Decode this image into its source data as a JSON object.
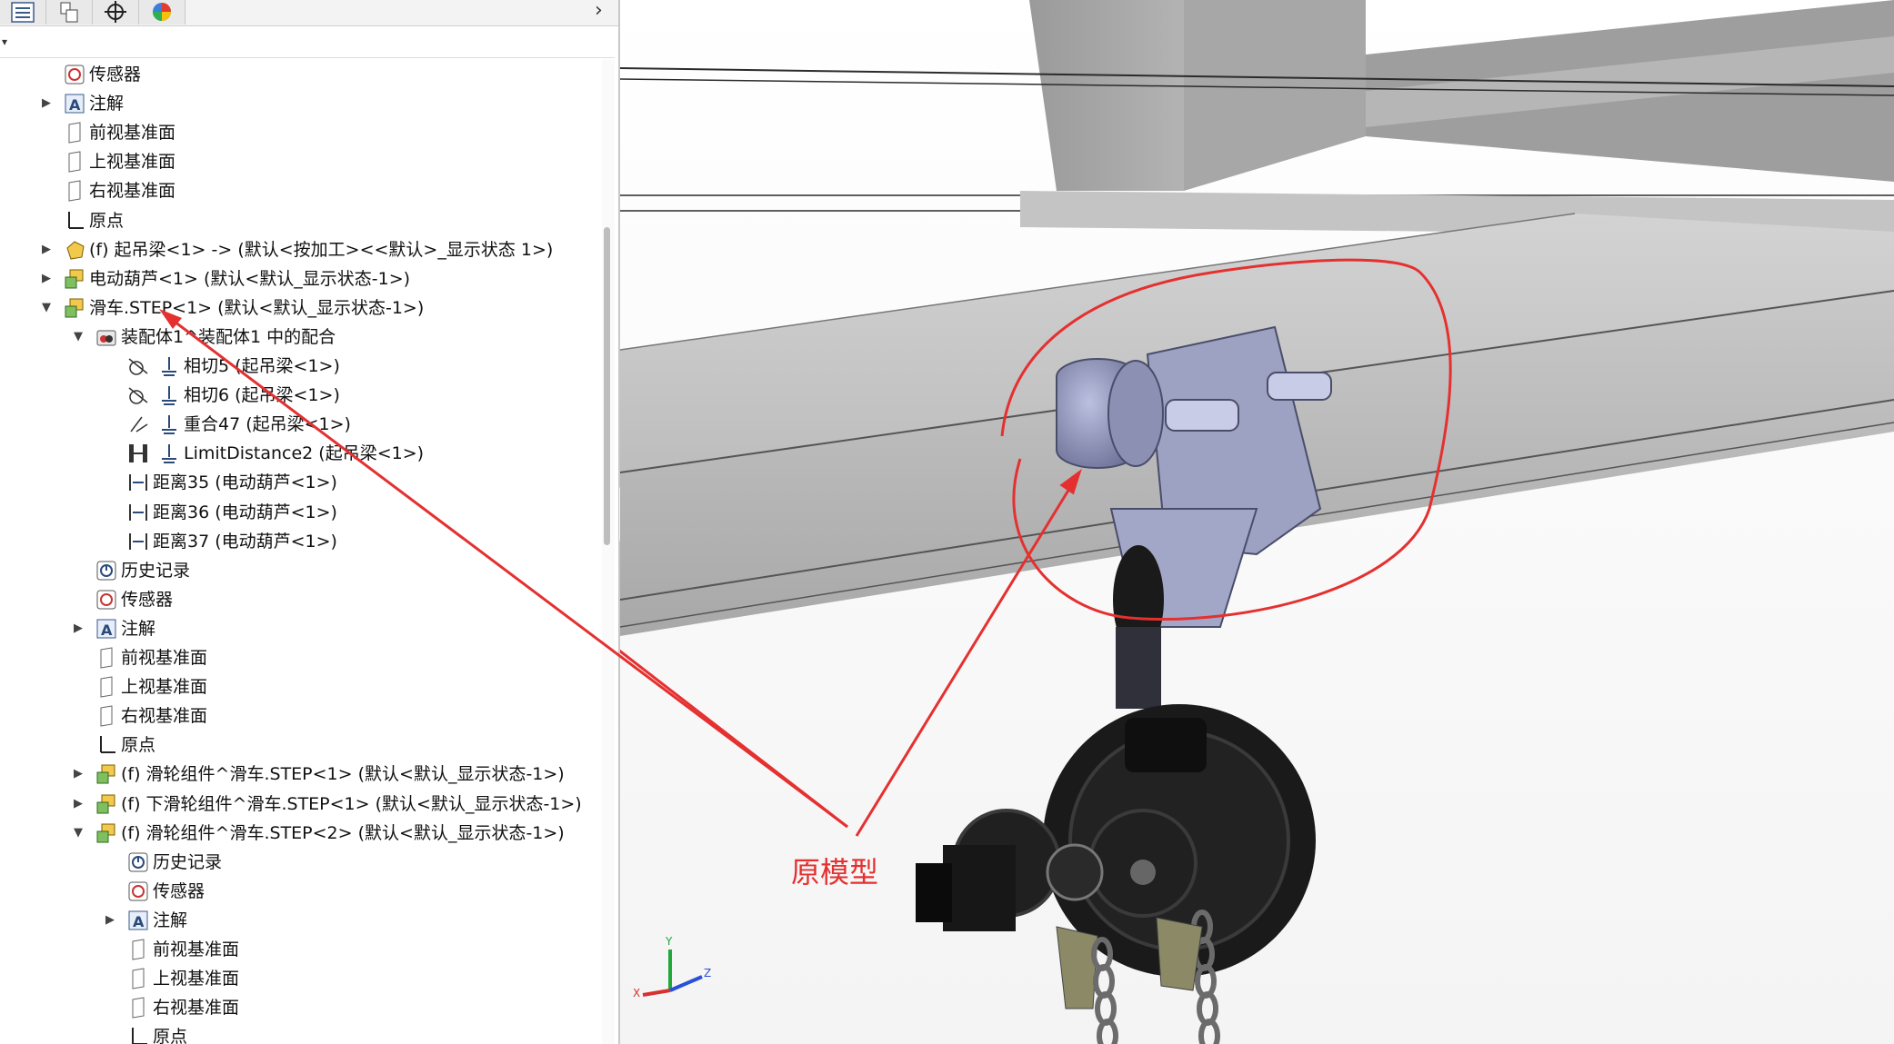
{
  "tabs": [
    {
      "name": "feature-manager-tab"
    },
    {
      "name": "property-manager-tab"
    },
    {
      "name": "configuration-manager-tab"
    },
    {
      "name": "dimxpert-tab"
    },
    {
      "name": "display-manager-tab"
    }
  ],
  "tree": {
    "rows": [
      {
        "label": "传感器",
        "icon": "sensor-icon"
      },
      {
        "label": "注解",
        "icon": "annotation-icon",
        "toggle": "collapsed"
      },
      {
        "label": "前视基准面",
        "icon": "plane-icon"
      },
      {
        "label": "上视基准面",
        "icon": "plane-icon"
      },
      {
        "label": "右视基准面",
        "icon": "plane-icon"
      },
      {
        "label": "原点",
        "icon": "origin-icon"
      },
      {
        "label": "(f) 起吊梁<1> -> (默认<按加工><<默认>_显示状态 1>)",
        "icon": "part-icon",
        "toggle": "collapsed"
      },
      {
        "label": "电动葫芦<1> (默认<默认_显示状态-1>)",
        "icon": "assembly-icon",
        "toggle": "collapsed"
      },
      {
        "label": "滑车.STEP<1> (默认<默认_显示状态-1>)",
        "icon": "assembly-icon",
        "toggle": "expanded"
      },
      {
        "label": "装配体1^装配体1 中的配合",
        "icon": "mates-folder-icon",
        "toggle": "expanded"
      },
      {
        "label": "相切5 (起吊梁<1>)",
        "icon": "tangent-mate-icon"
      },
      {
        "label": "相切6 (起吊梁<1>)",
        "icon": "tangent-mate-icon"
      },
      {
        "label": "重合47 (起吊梁<1>)",
        "icon": "coincident-mate-icon"
      },
      {
        "label": "LimitDistance2 (起吊梁<1>)",
        "icon": "limit-distance-icon"
      },
      {
        "label": "距离35 (电动葫芦<1>)",
        "icon": "distance-mate-icon"
      },
      {
        "label": "距离36 (电动葫芦<1>)",
        "icon": "distance-mate-icon"
      },
      {
        "label": "距离37 (电动葫芦<1>)",
        "icon": "distance-mate-icon"
      },
      {
        "label": "历史记录",
        "icon": "history-icon"
      },
      {
        "label": "传感器",
        "icon": "sensor-icon"
      },
      {
        "label": "注解",
        "icon": "annotation-icon",
        "toggle": "collapsed"
      },
      {
        "label": "前视基准面",
        "icon": "plane-icon"
      },
      {
        "label": "上视基准面",
        "icon": "plane-icon"
      },
      {
        "label": "右视基准面",
        "icon": "plane-icon"
      },
      {
        "label": "原点",
        "icon": "origin-icon"
      },
      {
        "label": "(f) 滑轮组件^滑车.STEP<1> (默认<默认_显示状态-1>)",
        "icon": "assembly-icon",
        "toggle": "collapsed"
      },
      {
        "label": "(f) 下滑轮组件^滑车.STEP<1> (默认<默认_显示状态-1>)",
        "icon": "assembly-icon",
        "toggle": "collapsed"
      },
      {
        "label": "(f) 滑轮组件^滑车.STEP<2> (默认<默认_显示状态-1>)",
        "icon": "assembly-icon",
        "toggle": "expanded"
      },
      {
        "label": "历史记录",
        "icon": "history-icon"
      },
      {
        "label": "传感器",
        "icon": "sensor-icon"
      },
      {
        "label": "注解",
        "icon": "annotation-icon",
        "toggle": "collapsed"
      },
      {
        "label": "前视基准面",
        "icon": "plane-icon"
      },
      {
        "label": "上视基准面",
        "icon": "plane-icon"
      },
      {
        "label": "右视基准面",
        "icon": "plane-icon"
      },
      {
        "label": "原点",
        "icon": "origin-icon"
      }
    ]
  },
  "annotation": {
    "label": "原模型",
    "color": "#e53030"
  },
  "triad": {
    "x": "X",
    "y": "Y",
    "z": "Z"
  },
  "colors": {
    "accent": "#e53030",
    "beam": "#b9b9b9"
  }
}
